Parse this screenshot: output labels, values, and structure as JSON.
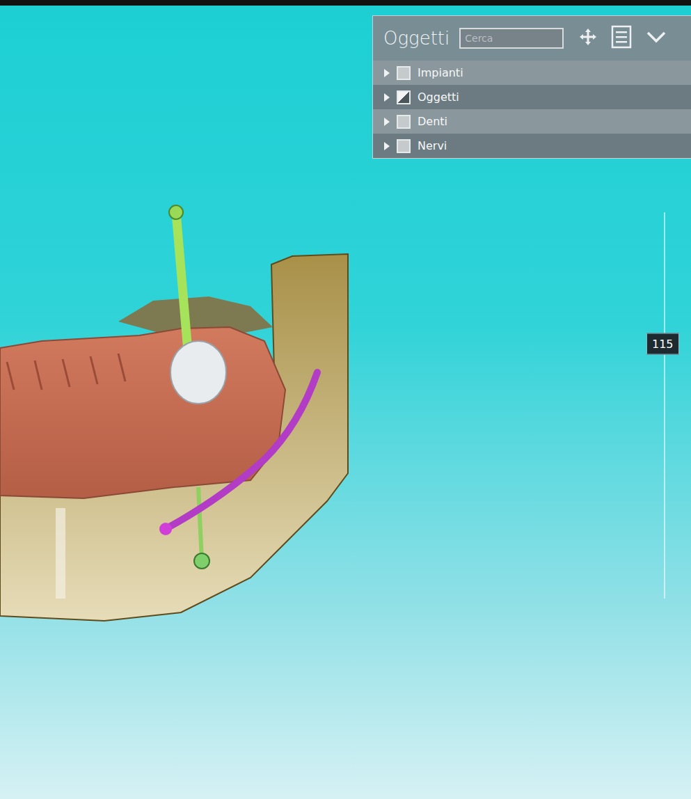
{
  "panel": {
    "title": "Oggetti",
    "search": {
      "placeholder": "Cerca"
    },
    "items": [
      {
        "label": "Impianti",
        "expanded": false,
        "visibility": "all"
      },
      {
        "label": "Oggetti",
        "expanded": false,
        "visibility": "partial"
      },
      {
        "label": "Denti",
        "expanded": false,
        "visibility": "all"
      },
      {
        "label": "Nervi",
        "expanded": false,
        "visibility": "all"
      }
    ]
  },
  "slider": {
    "level": 0.66,
    "reading": "115"
  }
}
